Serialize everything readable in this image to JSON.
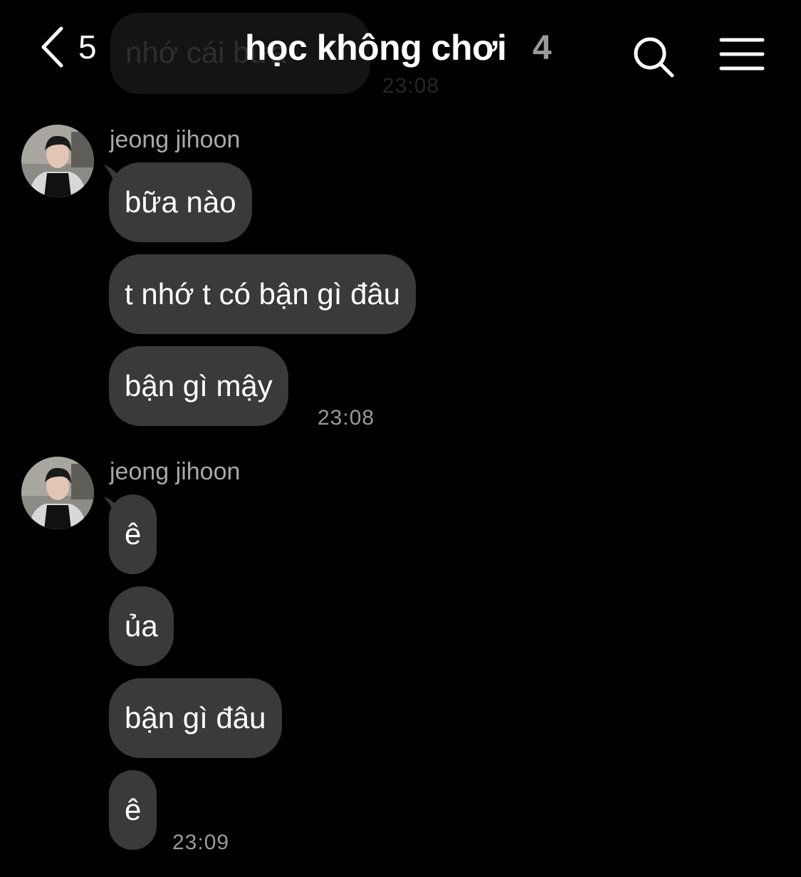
{
  "header": {
    "back_count": "5",
    "title": "học không chơi",
    "member_count": "4"
  },
  "previous": {
    "text": "nhớ cái bữa",
    "time": "23:08"
  },
  "groups": [
    {
      "sender": "jeong jihoon",
      "messages": [
        "bữa nào",
        "t nhớ t có bận gì đâu",
        "bận gì mậy"
      ],
      "time": "23:08"
    },
    {
      "sender": "jeong jihoon",
      "messages": [
        "ê",
        "ủa",
        "bận gì đâu",
        "ê"
      ],
      "time": "23:09"
    }
  ],
  "colors": {
    "background": "#000000",
    "bubble": "#3a3a3c",
    "meta_text": "#9a9a9a"
  },
  "icons": [
    "back-chevron-icon",
    "search-icon",
    "hamburger-menu-icon"
  ]
}
